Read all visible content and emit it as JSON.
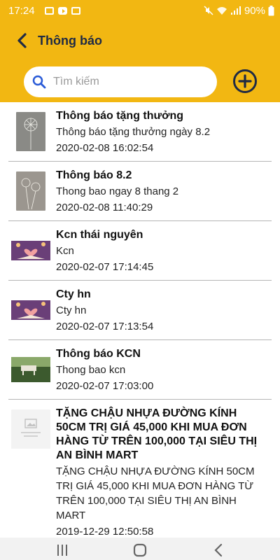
{
  "status": {
    "time": "17:24",
    "battery": "90%"
  },
  "header": {
    "title": "Thông báo"
  },
  "search": {
    "placeholder": "Tìm kiếm"
  },
  "notifications": [
    {
      "title": "Thông báo tặng thưởng",
      "body": "Thông báo tặng thưởng ngày 8.2",
      "time": "2020-02-08 16:02:54",
      "thumb": "dandelion"
    },
    {
      "title": "Thông báo 8.2",
      "body": "Thong bao ngay 8 thang 2",
      "time": "2020-02-08 11:40:29",
      "thumb": "dandelion"
    },
    {
      "title": "Kcn thái nguyên",
      "body": "Kcn",
      "time": "2020-02-07 17:14:45",
      "thumb": "book-heart"
    },
    {
      "title": "Cty hn",
      "body": "Cty hn",
      "time": "2020-02-07 17:13:54",
      "thumb": "book-heart"
    },
    {
      "title": "Thông báo KCN",
      "body": "Thong bao kcn",
      "time": "2020-02-07 17:03:00",
      "thumb": "bench"
    },
    {
      "title": "TẶNG CHẬU NHỰA ĐƯỜNG KÍNH 50CM TRỊ GIÁ 45,000 KHI MUA ĐƠN HÀNG TỪ TRÊN 100,000 TẠI SIÊU THỊ AN BÌNH MART",
      "body": "TẶNG CHẬU NHỰA ĐƯỜNG KÍNH 50CM TRỊ GIÁ 45,000 KHI MUA ĐƠN HÀNG TỪ TRÊN 100,000 TẠI SIÊU THỊ AN BÌNH MART",
      "time": "2019-12-29 12:50:58",
      "thumb": "placeholder"
    }
  ],
  "colors": {
    "accent": "#f2b712",
    "title": "#1f2a44",
    "search_icon": "#2a5bd7"
  },
  "icons": {
    "back": "back-arrow-icon",
    "search": "search-icon",
    "add": "add-circle-icon"
  }
}
